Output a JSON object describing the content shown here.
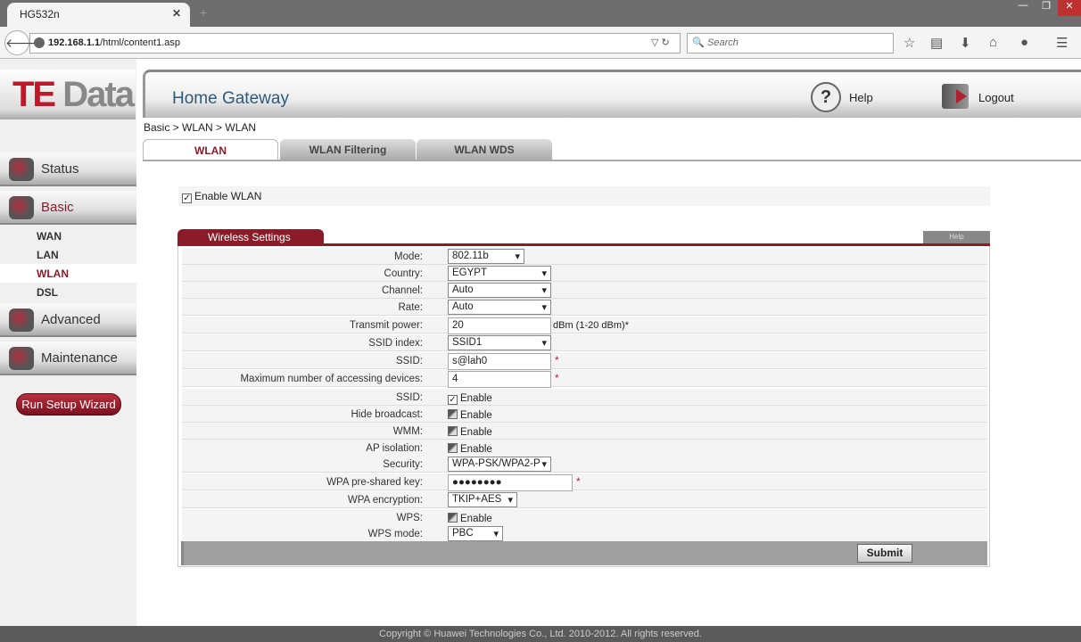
{
  "browser": {
    "tab_title": "HG532n",
    "url_host": "192.168.1.1",
    "url_path": "/html/content1.asp",
    "search_placeholder": "Search"
  },
  "header": {
    "logo_text_red": "TE",
    "logo_text_gray": " Data",
    "title": "Home Gateway",
    "help": "Help",
    "logout": "Logout"
  },
  "sidebar": {
    "items": [
      {
        "label": "Status",
        "icon": "status-icon"
      },
      {
        "label": "Basic",
        "icon": "basic-icon"
      },
      {
        "label": "Advanced",
        "icon": "advanced-icon"
      },
      {
        "label": "Maintenance",
        "icon": "maintenance-icon"
      }
    ],
    "basic_sub": [
      "WAN",
      "LAN",
      "WLAN",
      "DSL"
    ],
    "active_sub": "WLAN",
    "wizard": "Run Setup Wizard"
  },
  "breadcrumb": "Basic > WLAN > WLAN",
  "tabs": [
    "WLAN",
    "WLAN Filtering",
    "WLAN WDS"
  ],
  "enable_wlan": {
    "label": "Enable WLAN",
    "checked": true
  },
  "section": {
    "title": "Wireless Settings",
    "help": "Help"
  },
  "rows": [
    {
      "label": "Mode:",
      "type": "select",
      "value": "802.11b"
    },
    {
      "label": "Country:",
      "type": "select",
      "value": "EGYPT"
    },
    {
      "label": "Channel:",
      "type": "select",
      "value": "Auto"
    },
    {
      "label": "Rate:",
      "type": "select",
      "value": "Auto"
    },
    {
      "label": "Transmit power:",
      "type": "text",
      "value": "20",
      "suffix": "dBm (1-20 dBm)*"
    },
    {
      "label": "SSID index:",
      "type": "select",
      "value": "SSID1"
    },
    {
      "label": "SSID:",
      "type": "text",
      "value": "s@lah0",
      "required": "*"
    },
    {
      "label": "Maximum number of accessing devices:",
      "type": "text",
      "value": "4",
      "required": "*"
    },
    {
      "label": "SSID:",
      "type": "checkbox",
      "checked": true,
      "text": "Enable"
    },
    {
      "label": "Hide broadcast:",
      "type": "checkbox",
      "checked": false,
      "text": "Enable"
    },
    {
      "label": "WMM:",
      "type": "checkbox",
      "checked": false,
      "text": "Enable"
    },
    {
      "label": "AP isolation:",
      "type": "checkbox",
      "checked": false,
      "text": "Enable"
    },
    {
      "label": "Security:",
      "type": "select",
      "value": "WPA-PSK/WPA2-P"
    },
    {
      "label": "WPA pre-shared key:",
      "type": "password",
      "value": "●●●●●●●●",
      "required": "*"
    },
    {
      "label": "WPA encryption:",
      "type": "select",
      "value": "TKIP+AES"
    },
    {
      "label": "WPS:",
      "type": "checkbox",
      "checked": false,
      "text": "Enable"
    },
    {
      "label": "WPS mode:",
      "type": "select",
      "value": "PBC"
    }
  ],
  "submit": "Submit",
  "footer": "Copyright © Huawei Technologies Co., Ltd. 2010-2012. All rights reserved."
}
